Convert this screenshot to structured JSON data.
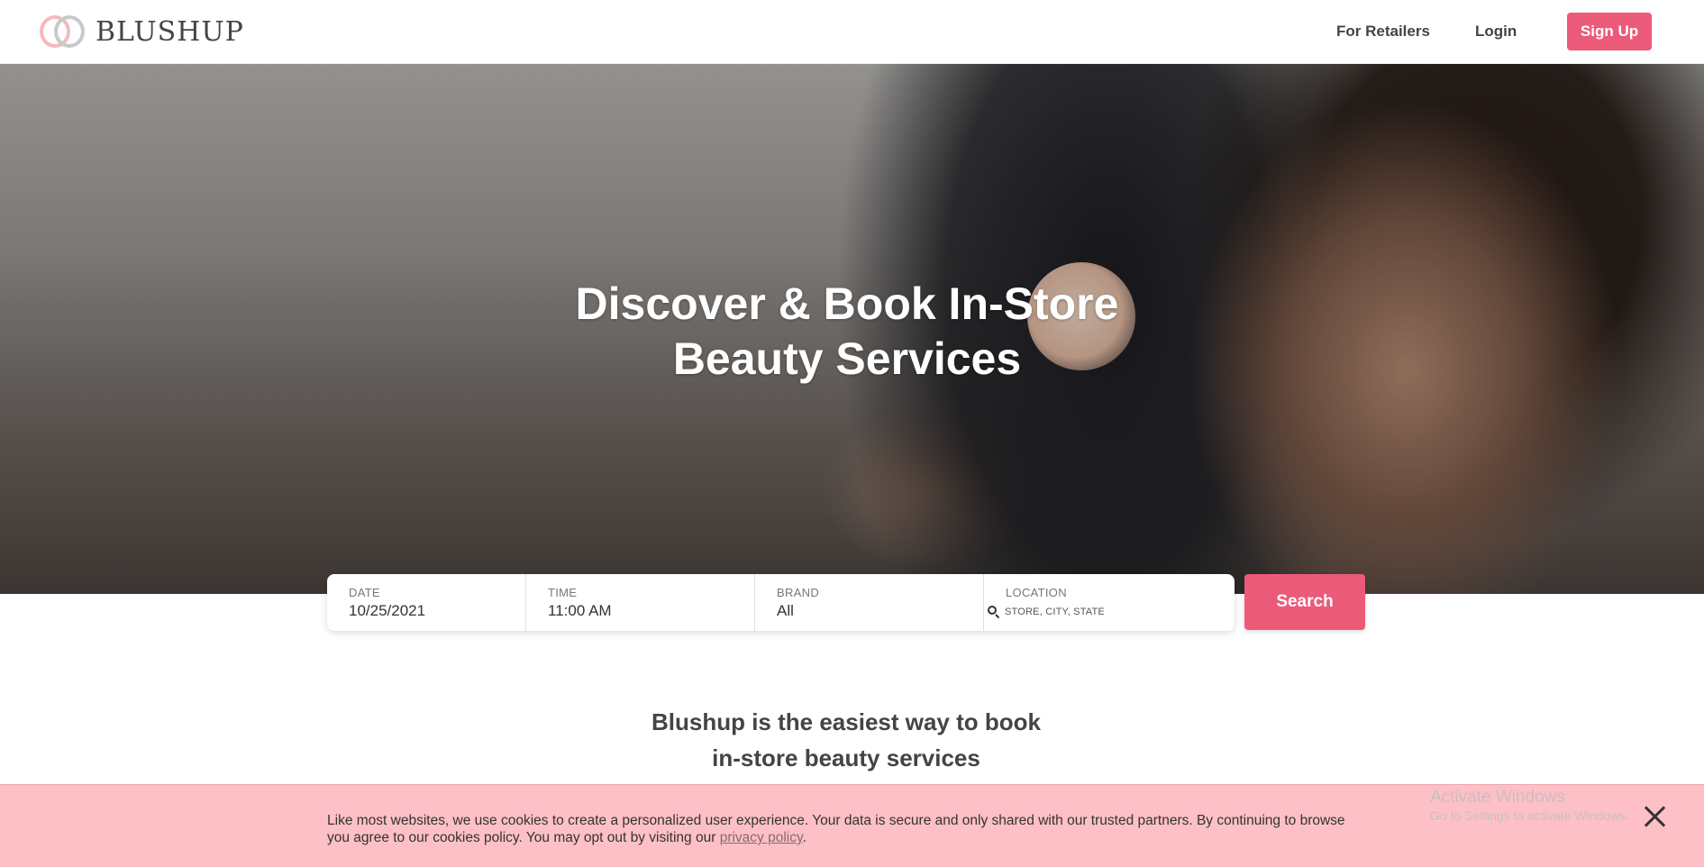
{
  "header": {
    "logo_text": "BLUSHUP",
    "nav": {
      "retailers": "For Retailers",
      "login": "Login",
      "signup": "Sign Up"
    }
  },
  "hero": {
    "title_line1": "Discover & Book In-Store",
    "title_line2": "Beauty Services"
  },
  "search": {
    "date": {
      "label": "DATE",
      "value": "10/25/2021"
    },
    "time": {
      "label": "TIME",
      "value": "11:00 AM"
    },
    "brand": {
      "label": "BRAND",
      "value": "All"
    },
    "location": {
      "label": "LOCATION",
      "placeholder": "STORE, CITY, STATE"
    },
    "button": "Search"
  },
  "tagline": {
    "line1": "Blushup is the easiest way to book",
    "line2": "in-store beauty services"
  },
  "cookie_banner": {
    "text": "Like most websites, we use cookies to create a personalized user experience. Your data is secure and only shared with our trusted partners. By continuing to browse you agree to our cookies policy. You may opt out by visiting our",
    "link": "privacy policy",
    "suffix": "."
  },
  "watermark": {
    "title": "Activate Windows",
    "subtitle": "Go to Settings to activate Windows."
  },
  "colors": {
    "accent": "#ec5a7a",
    "cookie_bg": "#fdc0c6"
  }
}
